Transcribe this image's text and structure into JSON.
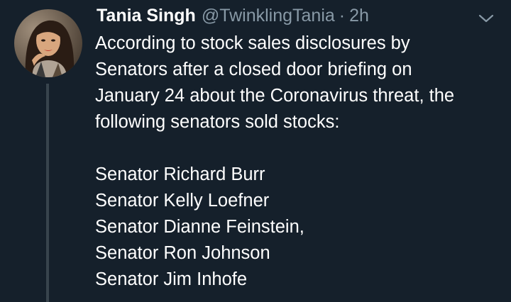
{
  "tweet": {
    "author_name": "Tania Singh",
    "handle": "@TwinklingTania",
    "separator": "·",
    "time": "2h",
    "text_lines": [
      "According to stock sales disclosures by",
      "Senators after a closed door briefing on",
      "January 24 about the Coronavirus threat, the",
      "following senators sold stocks:"
    ],
    "senators": [
      "Senator Richard Burr",
      "Senator Kelly Loefner",
      "Senator Dianne Feinstein,",
      "Senator Ron Johnson",
      "Senator Jim Inhofe"
    ]
  },
  "icons": {
    "more": "chevron-down-icon"
  },
  "colors": {
    "background": "#15202b",
    "text": "#ffffff",
    "secondary": "#8899a6",
    "thread_line": "#38444d"
  }
}
